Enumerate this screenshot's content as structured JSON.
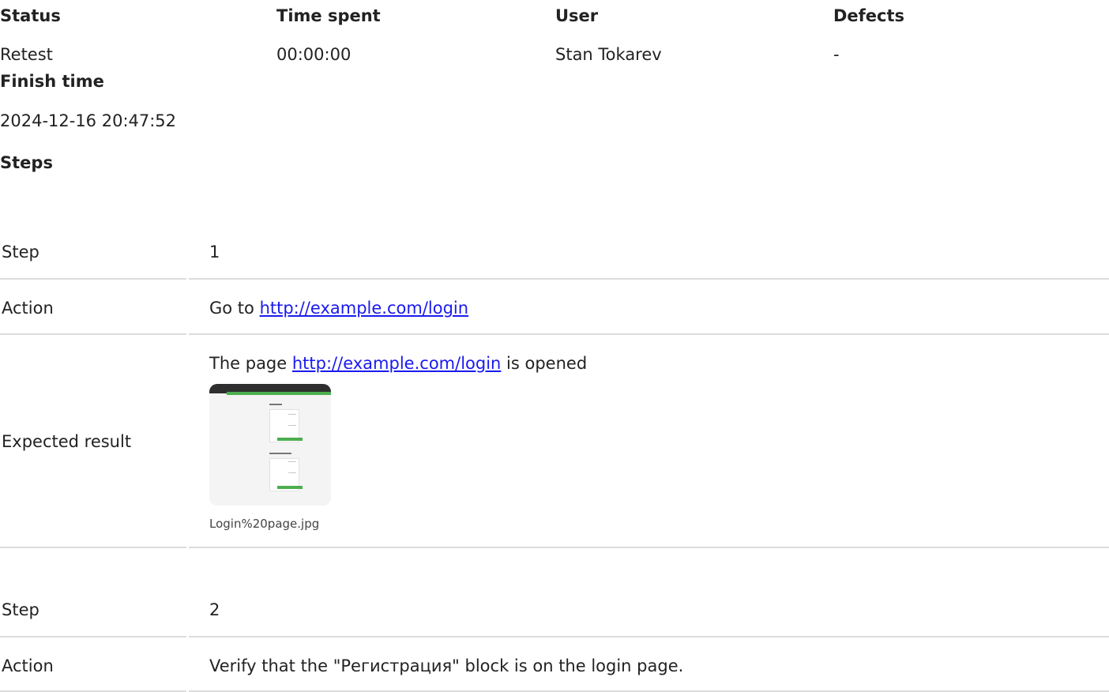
{
  "summary": {
    "headers": {
      "status": "Status",
      "time_spent": "Time spent",
      "user": "User",
      "defects": "Defects"
    },
    "values": {
      "status": "Retest",
      "time_spent": "00:00:00",
      "user": "Stan Tokarev",
      "defects": "-"
    },
    "finish_time_label": "Finish time",
    "finish_time_value": "2024-12-16 20:47:52",
    "steps_label": "Steps"
  },
  "steps": [
    {
      "step_label": "Step",
      "step_number": "1",
      "action_label": "Action",
      "action_prefix": "Go to",
      "action_link": "http://example.com/login",
      "expected_label": "Expected result",
      "expected_prefix": "The page",
      "expected_link": "http://example.com/login",
      "expected_suffix": "is opened",
      "attachment_name": "Login%20page.jpg"
    },
    {
      "step_label": "Step",
      "step_number": "2",
      "action_label": "Action",
      "action_text": "Verify that the \"Регистрация\" block is on the login page."
    }
  ],
  "colors": {
    "link": "#1a1aee",
    "divider": "#dcdcdc",
    "thumb_green": "#4cae4f"
  }
}
